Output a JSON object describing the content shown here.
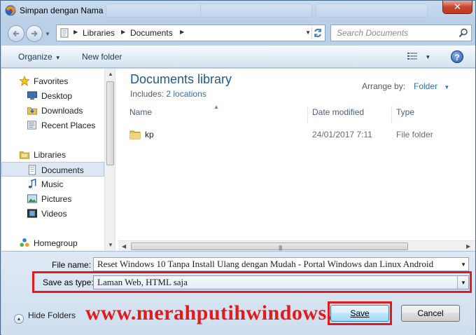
{
  "window": {
    "title": "Simpan dengan Nama",
    "close_glyph": "✕"
  },
  "address": {
    "crumbs": [
      "Libraries",
      "Documents"
    ],
    "search_placeholder": "Search Documents"
  },
  "toolbar": {
    "organize": "Organize",
    "new_folder": "New folder",
    "help_glyph": "?"
  },
  "sidebar": {
    "items": [
      {
        "label": "Favorites",
        "icon": "star-icon"
      },
      {
        "label": "Desktop",
        "icon": "desktop-icon"
      },
      {
        "label": "Downloads",
        "icon": "downloads-folder-icon"
      },
      {
        "label": "Recent Places",
        "icon": "recent-places-icon"
      },
      {
        "label": "Libraries",
        "icon": "libraries-icon"
      },
      {
        "label": "Documents",
        "icon": "documents-icon",
        "selected": true
      },
      {
        "label": "Music",
        "icon": "music-icon"
      },
      {
        "label": "Pictures",
        "icon": "pictures-icon"
      },
      {
        "label": "Videos",
        "icon": "videos-icon"
      },
      {
        "label": "Homegroup",
        "icon": "homegroup-icon"
      }
    ]
  },
  "library": {
    "title": "Documents library",
    "includes_label": "Includes:",
    "includes_link": "2 locations",
    "arrange_label": "Arrange by:",
    "arrange_value": "Folder"
  },
  "columns": [
    "Name",
    "Date modified",
    "Type"
  ],
  "files": [
    {
      "name": "kp",
      "date": "24/01/2017 7:11",
      "type": "File folder"
    }
  ],
  "form": {
    "filename_label": "File name:",
    "filename_value": "Reset Windows 10 Tanpa Install Ulang dengan Mudah - Portal Windows dan Linux Android",
    "savetype_label": "Save as type:",
    "savetype_value": "Laman Web, HTML saja",
    "hide_folders": "Hide Folders",
    "watermark": "www.merahputihwindows.net",
    "save": "Save",
    "cancel": "Cancel"
  },
  "colors": {
    "highlight_red": "#e01b1b",
    "link_blue": "#2f6fb3",
    "title_blue": "#1e5a8e"
  }
}
